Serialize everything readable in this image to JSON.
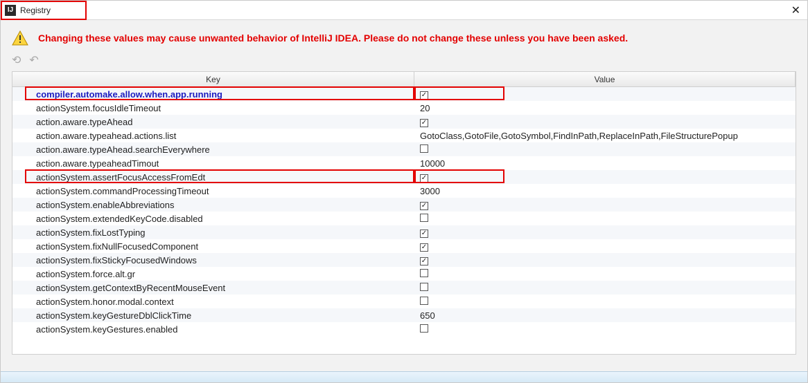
{
  "window": {
    "title": "Registry",
    "close": "✕"
  },
  "warning": "Changing these values may cause unwanted behavior of IntelliJ IDEA. Please do not change these unless you have been asked.",
  "columns": {
    "key": "Key",
    "value": "Value"
  },
  "toolbar": {
    "restart": "⟲",
    "undo": "↶"
  },
  "rows": [
    {
      "key": "compiler.automake.allow.when.app.running",
      "type": "check",
      "checked": true,
      "bold": true,
      "highlight": true
    },
    {
      "key": "actionSystem.focusIdleTimeout",
      "type": "text",
      "value": "20"
    },
    {
      "key": "action.aware.typeAhead",
      "type": "check",
      "checked": true
    },
    {
      "key": "action.aware.typeahead.actions.list",
      "type": "text",
      "value": "GotoClass,GotoFile,GotoSymbol,FindInPath,ReplaceInPath,FileStructurePopup"
    },
    {
      "key": "action.aware.typeAhead.searchEverywhere",
      "type": "check",
      "checked": false
    },
    {
      "key": "action.aware.typeaheadTimout",
      "type": "text",
      "value": "10000"
    },
    {
      "key": "actionSystem.assertFocusAccessFromEdt",
      "type": "check",
      "checked": true,
      "highlight": true
    },
    {
      "key": "actionSystem.commandProcessingTimeout",
      "type": "text",
      "value": "3000"
    },
    {
      "key": "actionSystem.enableAbbreviations",
      "type": "check",
      "checked": true
    },
    {
      "key": "actionSystem.extendedKeyCode.disabled",
      "type": "check",
      "checked": false
    },
    {
      "key": "actionSystem.fixLostTyping",
      "type": "check",
      "checked": true
    },
    {
      "key": "actionSystem.fixNullFocusedComponent",
      "type": "check",
      "checked": true
    },
    {
      "key": "actionSystem.fixStickyFocusedWindows",
      "type": "check",
      "checked": true
    },
    {
      "key": "actionSystem.force.alt.gr",
      "type": "check",
      "checked": false
    },
    {
      "key": "actionSystem.getContextByRecentMouseEvent",
      "type": "check",
      "checked": false
    },
    {
      "key": "actionSystem.honor.modal.context",
      "type": "check",
      "checked": false
    },
    {
      "key": "actionSystem.keyGestureDblClickTime",
      "type": "text",
      "value": "650"
    },
    {
      "key": "actionSystem.keyGestures.enabled",
      "type": "check",
      "checked": false
    }
  ]
}
